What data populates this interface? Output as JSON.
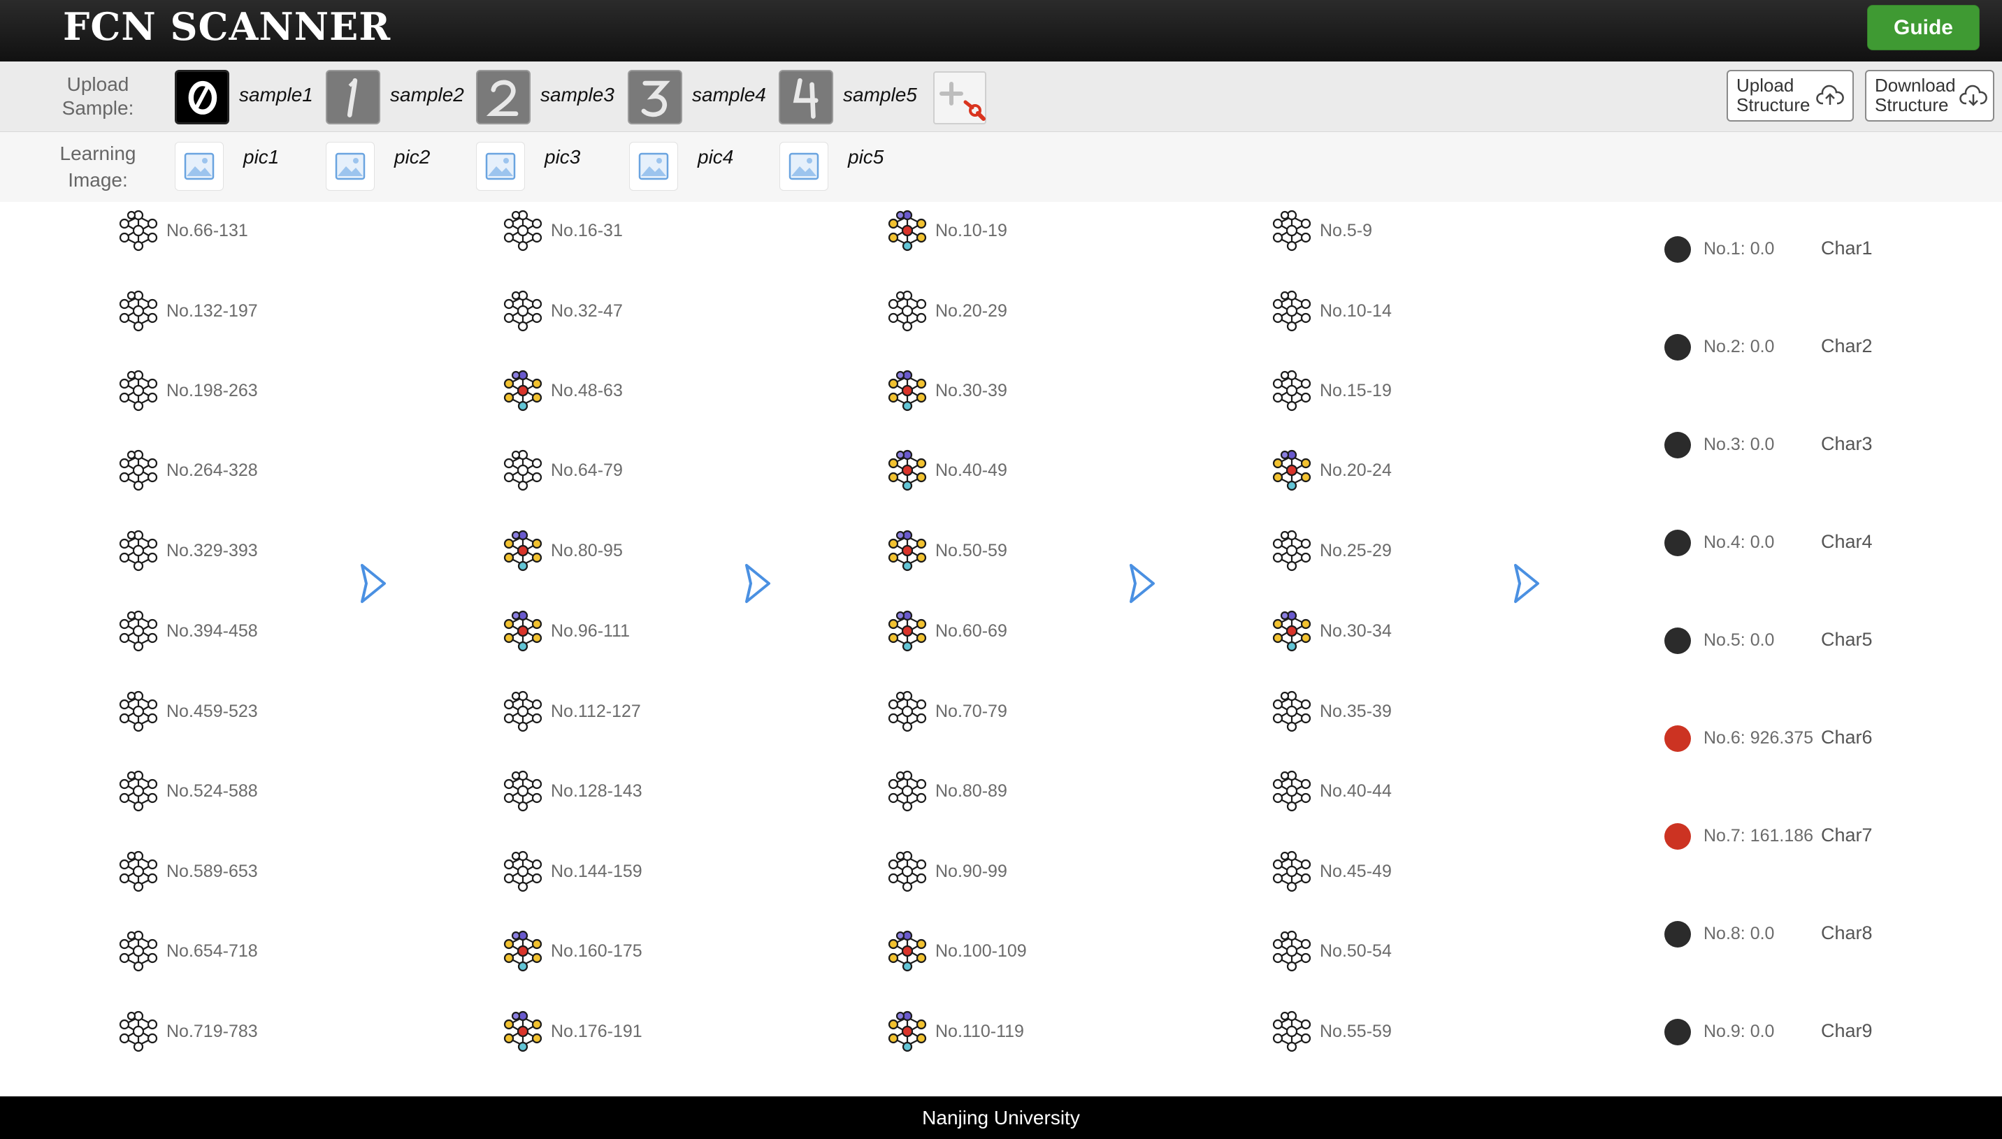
{
  "app": {
    "title": "FCN SCANNER",
    "guide_label": "Guide",
    "footer": "Nanjing University"
  },
  "upload": {
    "label_line1": "Upload",
    "label_line2": "Sample:",
    "samples": [
      {
        "label": "sample1",
        "digit": "0",
        "selected": true
      },
      {
        "label": "sample2",
        "digit": "1",
        "selected": false
      },
      {
        "label": "sample3",
        "digit": "2",
        "selected": false
      },
      {
        "label": "sample4",
        "digit": "3",
        "selected": false
      },
      {
        "label": "sample5",
        "digit": "4",
        "selected": false
      }
    ],
    "upload_structure_line1": "Upload",
    "upload_structure_line2": "Structure",
    "download_structure_line1": "Download",
    "download_structure_line2": "Structure"
  },
  "learning": {
    "label_line1": "Learning",
    "label_line2": "Image:",
    "pics": [
      "pic1",
      "pic2",
      "pic3",
      "pic4",
      "pic5"
    ]
  },
  "layers": [
    {
      "items": [
        {
          "label": "No.66-131",
          "active": false
        },
        {
          "label": "No.132-197",
          "active": false
        },
        {
          "label": "No.198-263",
          "active": false
        },
        {
          "label": "No.264-328",
          "active": false
        },
        {
          "label": "No.329-393",
          "active": false
        },
        {
          "label": "No.394-458",
          "active": false
        },
        {
          "label": "No.459-523",
          "active": false
        },
        {
          "label": "No.524-588",
          "active": false
        },
        {
          "label": "No.589-653",
          "active": false
        },
        {
          "label": "No.654-718",
          "active": false
        },
        {
          "label": "No.719-783",
          "active": false
        }
      ]
    },
    {
      "items": [
        {
          "label": "No.16-31",
          "active": false
        },
        {
          "label": "No.32-47",
          "active": false
        },
        {
          "label": "No.48-63",
          "active": true
        },
        {
          "label": "No.64-79",
          "active": false
        },
        {
          "label": "No.80-95",
          "active": true
        },
        {
          "label": "No.96-111",
          "active": true
        },
        {
          "label": "No.112-127",
          "active": false
        },
        {
          "label": "No.128-143",
          "active": false
        },
        {
          "label": "No.144-159",
          "active": false
        },
        {
          "label": "No.160-175",
          "active": true
        },
        {
          "label": "No.176-191",
          "active": true
        }
      ]
    },
    {
      "items": [
        {
          "label": "No.10-19",
          "active": true
        },
        {
          "label": "No.20-29",
          "active": false
        },
        {
          "label": "No.30-39",
          "active": true
        },
        {
          "label": "No.40-49",
          "active": true
        },
        {
          "label": "No.50-59",
          "active": true
        },
        {
          "label": "No.60-69",
          "active": true
        },
        {
          "label": "No.70-79",
          "active": false
        },
        {
          "label": "No.80-89",
          "active": false
        },
        {
          "label": "No.90-99",
          "active": false
        },
        {
          "label": "No.100-109",
          "active": true
        },
        {
          "label": "No.110-119",
          "active": true
        }
      ]
    },
    {
      "items": [
        {
          "label": "No.5-9",
          "active": false
        },
        {
          "label": "No.10-14",
          "active": false
        },
        {
          "label": "No.15-19",
          "active": false
        },
        {
          "label": "No.20-24",
          "active": true
        },
        {
          "label": "No.25-29",
          "active": false
        },
        {
          "label": "No.30-34",
          "active": true
        },
        {
          "label": "No.35-39",
          "active": false
        },
        {
          "label": "No.40-44",
          "active": false
        },
        {
          "label": "No.45-49",
          "active": false
        },
        {
          "label": "No.50-54",
          "active": false
        },
        {
          "label": "No.55-59",
          "active": false
        }
      ]
    }
  ],
  "outputs": [
    {
      "value": "No.1: 0.0",
      "char": "Char1",
      "active": false
    },
    {
      "value": "No.2: 0.0",
      "char": "Char2",
      "active": false
    },
    {
      "value": "No.3: 0.0",
      "char": "Char3",
      "active": false
    },
    {
      "value": "No.4: 0.0",
      "char": "Char4",
      "active": false
    },
    {
      "value": "No.5: 0.0",
      "char": "Char5",
      "active": false
    },
    {
      "value": "No.6: 926.375",
      "char": "Char6",
      "active": true
    },
    {
      "value": "No.7: 161.186",
      "char": "Char7",
      "active": true
    },
    {
      "value": "No.8: 0.0",
      "char": "Char8",
      "active": false
    },
    {
      "value": "No.9: 0.0",
      "char": "Char9",
      "active": false
    }
  ],
  "icons": {
    "layer_node": "neural-network-icon",
    "arrow": "chevron-right-icon",
    "add": "add-sample-icon",
    "cloud": "cloud-icon"
  },
  "colors": {
    "header_bg": "#1a1a1a",
    "guide_bg": "#3f9a33",
    "active_output": "#cc3322",
    "inactive_output": "#2b2b2b",
    "arrow": "#4a90e2"
  }
}
